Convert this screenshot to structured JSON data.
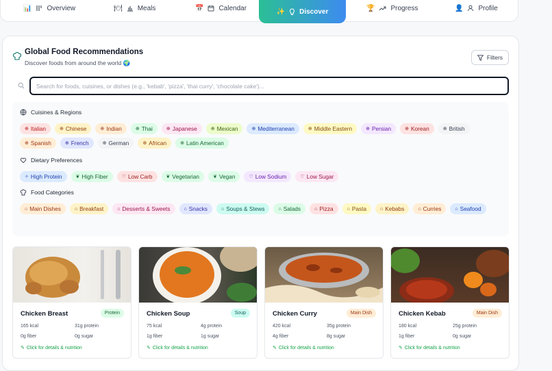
{
  "nav": {
    "items": [
      {
        "emoji": "📊",
        "icon": "grid-icon",
        "label": "Overview"
      },
      {
        "emoji": "🍽",
        "icon": "bar-chart-icon",
        "label": "Meals"
      },
      {
        "emoji": "📅",
        "icon": "calendar-icon",
        "label": "Calendar"
      },
      {
        "emoji": "🏆",
        "icon": "trending-icon",
        "label": "Progress"
      },
      {
        "emoji": "👤",
        "icon": "user-icon",
        "label": "Profile"
      }
    ],
    "active": {
      "emoji": "✨",
      "icon": "lightbulb-icon",
      "label": "Discover"
    }
  },
  "header": {
    "title": "Global Food Recommendations",
    "subtitle": "Discover foods from around the world 🌍",
    "filters_label": "Filters"
  },
  "search": {
    "placeholder": "Search for foods, cuisines, or dishes (e.g., 'kebab', 'pizza', 'thai curry', 'chocolate cake')..."
  },
  "cuisines": {
    "title": "Cuisines & Regions",
    "chips": [
      {
        "label": "Italian",
        "bg": "#fde2e2",
        "fg": "#b91c1c"
      },
      {
        "label": "Chinese",
        "bg": "#fef3c7",
        "fg": "#92400e"
      },
      {
        "label": "Indian",
        "bg": "#ffedd5",
        "fg": "#9a3412"
      },
      {
        "label": "Thai",
        "bg": "#dcfce7",
        "fg": "#166534"
      },
      {
        "label": "Japanese",
        "bg": "#fce7f3",
        "fg": "#9d174d"
      },
      {
        "label": "Mexican",
        "bg": "#ecfccb",
        "fg": "#3f6212"
      },
      {
        "label": "Mediterranean",
        "bg": "#dbeafe",
        "fg": "#1e40af"
      },
      {
        "label": "Middle Eastern",
        "bg": "#fef9c3",
        "fg": "#854d0e"
      },
      {
        "label": "Persian",
        "bg": "#f3e8ff",
        "fg": "#6b21a8"
      },
      {
        "label": "Korean",
        "bg": "#fee2e2",
        "fg": "#991b1b"
      },
      {
        "label": "British",
        "bg": "#f3f4f6",
        "fg": "#374151"
      },
      {
        "label": "Spanish",
        "bg": "#ffedd5",
        "fg": "#9a3412"
      },
      {
        "label": "French",
        "bg": "#e0e7ff",
        "fg": "#3730a3"
      },
      {
        "label": "German",
        "bg": "#f3f4f6",
        "fg": "#374151"
      },
      {
        "label": "African",
        "bg": "#fef3c7",
        "fg": "#92400e"
      },
      {
        "label": "Latin American",
        "bg": "#dcfce7",
        "fg": "#166534"
      }
    ]
  },
  "dietary": {
    "title": "Dietary Preferences",
    "chips": [
      {
        "label": "High Protein",
        "bg": "#dbeafe",
        "fg": "#1e40af",
        "sym": "✧"
      },
      {
        "label": "High Fiber",
        "bg": "#dcfce7",
        "fg": "#166534",
        "sym": "❦"
      },
      {
        "label": "Low Carb",
        "bg": "#fee2e2",
        "fg": "#991b1b",
        "sym": "♡"
      },
      {
        "label": "Vegetarian",
        "bg": "#dcfce7",
        "fg": "#166534",
        "sym": "❦"
      },
      {
        "label": "Vegan",
        "bg": "#dcfce7",
        "fg": "#166534",
        "sym": "❦"
      },
      {
        "label": "Low Sodium",
        "bg": "#f3e8ff",
        "fg": "#6b21a8",
        "sym": "♡"
      },
      {
        "label": "Low Sugar",
        "bg": "#fce7f3",
        "fg": "#9d174d",
        "sym": "♡"
      }
    ]
  },
  "categories": {
    "title": "Food Categories",
    "chips": [
      {
        "label": "Main Dishes",
        "bg": "#ffedd5",
        "fg": "#9a3412"
      },
      {
        "label": "Breakfast",
        "bg": "#fef3c7",
        "fg": "#92400e"
      },
      {
        "label": "Desserts & Sweets",
        "bg": "#fce7f3",
        "fg": "#9d174d"
      },
      {
        "label": "Snacks",
        "bg": "#e0e7ff",
        "fg": "#3730a3"
      },
      {
        "label": "Soups & Stews",
        "bg": "#ccfbf1",
        "fg": "#115e59"
      },
      {
        "label": "Salads",
        "bg": "#dcfce7",
        "fg": "#166534"
      },
      {
        "label": "Pizza",
        "bg": "#fee2e2",
        "fg": "#991b1b"
      },
      {
        "label": "Pasta",
        "bg": "#fef9c3",
        "fg": "#854d0e"
      },
      {
        "label": "Kebabs",
        "bg": "#fef3c7",
        "fg": "#92400e"
      },
      {
        "label": "Curries",
        "bg": "#ffedd5",
        "fg": "#9a3412"
      },
      {
        "label": "Seafood",
        "bg": "#dbeafe",
        "fg": "#1e40af"
      }
    ]
  },
  "foods": [
    {
      "name": "Chicken Breast",
      "tag": "Protein",
      "tag_bg": "#dcfce7",
      "tag_fg": "#166534",
      "kcal": "165 kcal",
      "protein": "31g protein",
      "fiber": "0g fiber",
      "sugar": "0g sugar",
      "details": "Click for details & nutrition"
    },
    {
      "name": "Chicken Soup",
      "tag": "Soup",
      "tag_bg": "#ccfbf1",
      "tag_fg": "#115e59",
      "kcal": "75 kcal",
      "protein": "4g protein",
      "fiber": "1g fiber",
      "sugar": "1g sugar",
      "details": "Click for details & nutrition"
    },
    {
      "name": "Chicken Curry",
      "tag": "Main Dish",
      "tag_bg": "#ffedd5",
      "tag_fg": "#9a3412",
      "kcal": "420 kcal",
      "protein": "35g protein",
      "fiber": "4g fiber",
      "sugar": "8g sugar",
      "details": "Click for details & nutrition"
    },
    {
      "name": "Chicken Kebab",
      "tag": "Main Dish",
      "tag_bg": "#ffedd5",
      "tag_fg": "#9a3412",
      "kcal": "180 kcal",
      "protein": "25g protein",
      "fiber": "1g fiber",
      "sugar": "0g sugar",
      "details": "Click for details & nutrition"
    }
  ]
}
